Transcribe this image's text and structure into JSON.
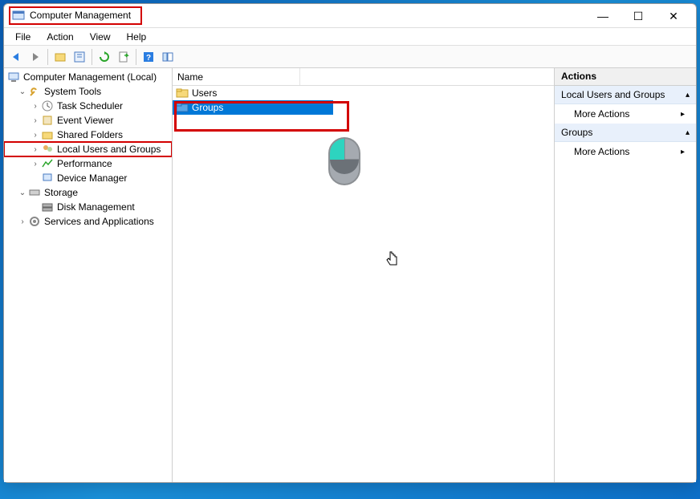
{
  "window": {
    "title": "Computer Management",
    "controls": {
      "minimize": "—",
      "maximize": "☐",
      "close": "✕"
    }
  },
  "menubar": [
    "File",
    "Action",
    "View",
    "Help"
  ],
  "tree": {
    "root": "Computer Management (Local)",
    "nodes": {
      "system_tools": "System Tools",
      "task_scheduler": "Task Scheduler",
      "event_viewer": "Event Viewer",
      "shared_folders": "Shared Folders",
      "local_users_groups": "Local Users and Groups",
      "performance": "Performance",
      "device_manager": "Device Manager",
      "storage": "Storage",
      "disk_management": "Disk Management",
      "services_apps": "Services and Applications"
    }
  },
  "list": {
    "header_name": "Name",
    "items": [
      {
        "label": "Users",
        "selected": false
      },
      {
        "label": "Groups",
        "selected": true
      }
    ]
  },
  "actions": {
    "header": "Actions",
    "sections": [
      {
        "title": "Local Users and Groups",
        "items": [
          "More Actions"
        ]
      },
      {
        "title": "Groups",
        "items": [
          "More Actions"
        ]
      }
    ]
  }
}
